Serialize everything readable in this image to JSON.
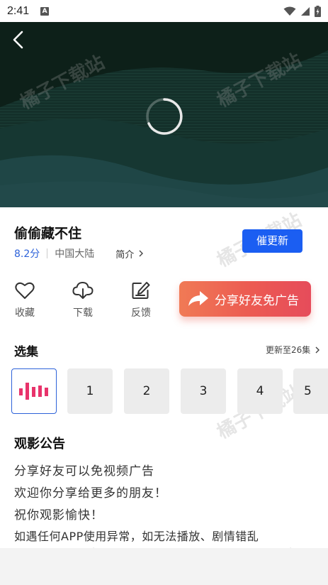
{
  "status_bar": {
    "time": "2:41",
    "a_badge": "A"
  },
  "video": {
    "watermark": "橘子下载站"
  },
  "show": {
    "title": "偷偷藏不住",
    "score": "8.2分",
    "region": "中国大陆",
    "intro_label": "简介",
    "urge_update_label": "催更新"
  },
  "actions": {
    "favorite_label": "收藏",
    "download_label": "下载",
    "feedback_label": "反馈",
    "share_label": "分享好友免广告"
  },
  "episodes": {
    "title": "选集",
    "update_info": "更新至26集",
    "items": [
      "1",
      "2",
      "3",
      "4",
      "5"
    ]
  },
  "notice": {
    "title": "观影公告",
    "lines": [
      "分享好友可以免视频广告",
      "欢迎你分享给更多的朋友！",
      "祝你观影愉快！",
      "如遇任何APP使用异常，如无法播放、剧情错乱"
    ]
  },
  "colors": {
    "accent": "#1b5ef2",
    "score": "#2d62d9",
    "share_start": "#f07a55",
    "share_end": "#e64c5b",
    "playing_bars": "#e8336b"
  }
}
